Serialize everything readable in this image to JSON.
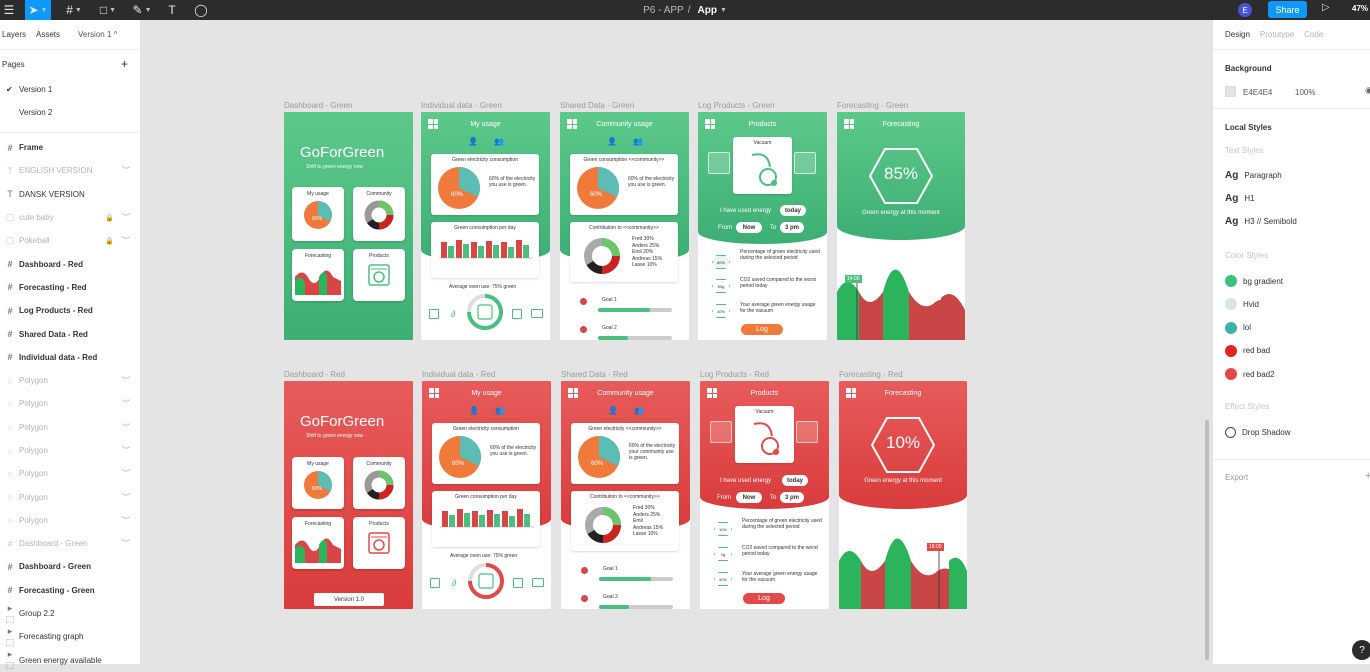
{
  "toolbar": {
    "file_name": "P6 - APP",
    "separator": "/",
    "page_name": "App",
    "avatar_initial": "E",
    "share_label": "Share",
    "zoom": "47%"
  },
  "left": {
    "tab_layers": "Layers",
    "tab_assets": "Assets",
    "version_label": "Version 1",
    "pages_label": "Pages",
    "pages": [
      "Version 1",
      "Version 2"
    ],
    "layers": [
      {
        "icon": "#",
        "name": "Frame",
        "style": "bold"
      },
      {
        "icon": "T",
        "name": "ENGLISH VERSION",
        "style": "dim"
      },
      {
        "icon": "T",
        "name": "DANSK VERSION",
        "style": "normal"
      },
      {
        "icon": "▢",
        "name": "cute baby",
        "style": "dim"
      },
      {
        "icon": "▢",
        "name": "Pokeball",
        "style": "dim"
      },
      {
        "icon": "#",
        "name": "Dashboard - Red",
        "style": "bold"
      },
      {
        "icon": "#",
        "name": "Forecasting - Red",
        "style": "bold"
      },
      {
        "icon": "#",
        "name": "Log Products - Red",
        "style": "bold"
      },
      {
        "icon": "#",
        "name": "Shared Data - Red",
        "style": "bold"
      },
      {
        "icon": "#",
        "name": "Individual data - Red",
        "style": "bold"
      },
      {
        "icon": "○",
        "name": "Polygon",
        "style": "dim"
      },
      {
        "icon": "○",
        "name": "Polygon",
        "style": "dim"
      },
      {
        "icon": "○",
        "name": "Polygon",
        "style": "dim"
      },
      {
        "icon": "○",
        "name": "Polygon",
        "style": "dim"
      },
      {
        "icon": "○",
        "name": "Polygon",
        "style": "dim"
      },
      {
        "icon": "○",
        "name": "Polygon",
        "style": "dim"
      },
      {
        "icon": "○",
        "name": "Polygon",
        "style": "dim"
      },
      {
        "icon": "#",
        "name": "Dashboard - Green",
        "style": "dim"
      },
      {
        "icon": "#",
        "name": "Dashboard - Green",
        "style": "bold"
      },
      {
        "icon": "#",
        "name": "Forecasting - Green",
        "style": "bold"
      },
      {
        "icon": "▸ ⬚",
        "name": "Group 2.2",
        "style": "normal"
      },
      {
        "icon": "▸ ⬚",
        "name": "Forecasting graph",
        "style": "normal"
      },
      {
        "icon": "▸ ⬚",
        "name": "Green energy available",
        "style": "normal"
      }
    ]
  },
  "right": {
    "tab_design": "Design",
    "tab_prototype": "Prototype",
    "tab_code": "Code",
    "background_label": "Background",
    "background_hex": "E4E4E4",
    "background_opacity": "100%",
    "local_styles_label": "Local Styles",
    "text_styles_label": "Text Styles",
    "text_styles": [
      "Paragraph",
      "H1",
      "H3 // Semibold"
    ],
    "text_style_glyph": "Ag",
    "color_styles_label": "Color Styles",
    "color_styles": [
      {
        "name": "bg gradient",
        "color": "#3cc17a"
      },
      {
        "name": "Hvid",
        "color": "#d6e8dd"
      },
      {
        "name": "lol",
        "color": "#3db3a4"
      },
      {
        "name": "red bad",
        "color": "#e52222"
      },
      {
        "name": "red bad2",
        "color": "#e14a4a"
      }
    ],
    "effect_styles_label": "Effect Styles",
    "effect_styles": [
      "Drop Shadow"
    ],
    "export_label": "Export"
  },
  "frames": {
    "green": {
      "dashboard_label": "Dashboard - Green",
      "individual_label": "Individual data - Green",
      "shared_label": "Shared Data - Green",
      "log_label": "Log Products - Green",
      "forecast_label": "Forecasting - Green"
    },
    "red": {
      "dashboard_label": "Dashboard - Red",
      "individual_label": "Individual data - Red",
      "shared_label": "Shared Data - Red",
      "log_label": "Log Products - Red",
      "forecast_label": "Forecasting - Red"
    }
  },
  "app": {
    "brand": "GoForGreen",
    "tagline": "Shift to green energy now",
    "tile_my_usage": "My usage",
    "tile_community": "Community",
    "tile_forecasting": "Forecasting",
    "tile_products": "Products",
    "pie_pct": "60%",
    "version_button": "Version 1.0",
    "my_usage_title": "My usage",
    "green_consumption_title": "Green electricity consumption",
    "green_consumption_text": "60% of the electricity you use is green.",
    "per_day_title": "Green consumption per day",
    "oven_text": "Average oven use: 75% green",
    "community_title": "Community usage",
    "community_consumption_title_green": "Green consumption <<community>>",
    "community_consumption_title_red": "Green electricity <<community>>",
    "community_consumption_text_green": "60% of the electricity you use is green.",
    "community_consumption_text_red": "60% of the electricity your community use is green.",
    "contribution_title": "Contribution to <<community>>",
    "contributors_green": [
      "Fred 30%",
      "Anders 25%",
      "Emil 20%",
      "Andreas 15%",
      "Lasse 10%"
    ],
    "contributors_red": [
      "Fred 30%",
      "Anders 25%",
      "Emil",
      "Andreas 15%",
      "Lasse 10%"
    ],
    "goal1": "Goal 1",
    "goal2": "Goal 2",
    "products_title": "Products",
    "vacuum": "Vacuum",
    "used_energy": "I have used energy",
    "today": "today",
    "from": "From",
    "now": "Now",
    "to": "To",
    "time": "3 pm",
    "pct_text": "Percentage of green electricity used during the selected period",
    "co2_text": "CO2 saved compared to the worst period today",
    "avg_text": "Your average green energy usage for the vacuum",
    "badge_green": [
      "60%",
      "50g",
      "40%"
    ],
    "badge_red": [
      "10%",
      "0g",
      "40%"
    ],
    "log_button": "Log",
    "forecast_title": "Forecasting",
    "forecast_pct_green": "85%",
    "forecast_pct_red": "10%",
    "forecast_caption": "Green energy at this moment",
    "time_marker_green": "14:00",
    "time_marker_red": "18:00",
    "colors": {
      "green": "#4cbf80",
      "red": "#e14a4a",
      "teal": "#5bbdb4",
      "orange": "#f07a3c"
    }
  }
}
